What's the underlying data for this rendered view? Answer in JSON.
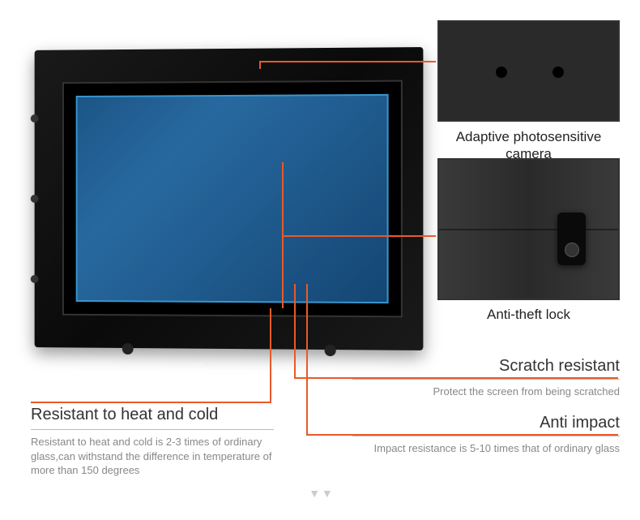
{
  "detail_images": {
    "camera": {
      "caption": "Adaptive photosensitive camera"
    },
    "lock": {
      "caption": "Anti-theft lock"
    }
  },
  "features": {
    "heat_cold": {
      "title": "Resistant to heat and cold",
      "desc": "Resistant to heat and cold is 2-3 times of ordinary glass,can withstand the difference in temperature of more than 150 degrees"
    },
    "scratch": {
      "title": "Scratch resistant",
      "desc": "Protect the screen from being scratched"
    },
    "impact": {
      "title": "Anti impact",
      "desc": "Impact resistance is 5-10 times that of ordinary glass"
    }
  }
}
